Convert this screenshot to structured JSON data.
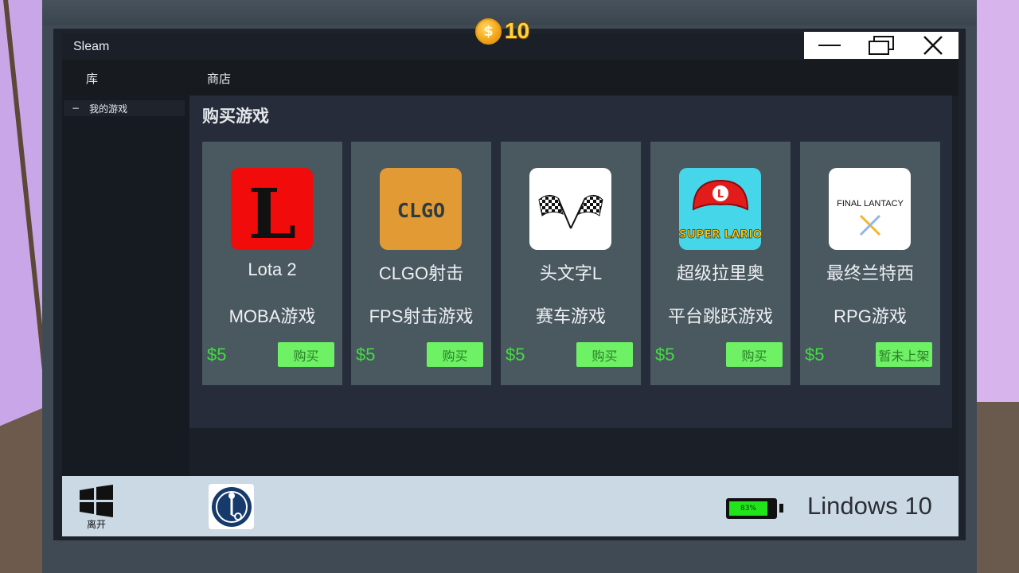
{
  "hud": {
    "coin_symbol": "$",
    "coins": "10"
  },
  "window": {
    "title": "Sleam"
  },
  "nav": {
    "library": "库",
    "store": "商店"
  },
  "sidebar": {
    "collapse_symbol": "−",
    "my_games": "我的游戏"
  },
  "store": {
    "heading": "购买游戏",
    "games": [
      {
        "name": "Lota 2",
        "genre": "MOBA游戏",
        "price": "$5",
        "button": "购买",
        "icon": "lota-logo-icon",
        "icon_text": "L"
      },
      {
        "name": "CLGO射击",
        "genre": "FPS射击游戏",
        "price": "$5",
        "button": "购买",
        "icon": "clgo-logo-icon",
        "icon_text": "CLGO"
      },
      {
        "name": "头文字L",
        "genre": "赛车游戏",
        "price": "$5",
        "button": "购买",
        "icon": "checkered-flags-icon"
      },
      {
        "name": "超级拉里奥",
        "genre": "平台跳跃游戏",
        "price": "$5",
        "button": "购买",
        "icon": "super-lario-logo-icon",
        "icon_text": "SUPER LARIO",
        "cap_letter": "L"
      },
      {
        "name": "最终兰特西",
        "genre": "RPG游戏",
        "price": "$5",
        "button": "暂未上架",
        "icon": "final-lantacy-logo-icon",
        "icon_text": "FINAL LANTACY"
      }
    ]
  },
  "taskbar": {
    "start_label": "离开",
    "battery_percent": "83%",
    "battery_level": 0.83,
    "os_name": "Lindows 10"
  },
  "colors": {
    "price": "#3ee13b",
    "buy_button": "#6ef165",
    "card": "#4a5860",
    "taskbar": "#cbd9e5",
    "coin": "#ffd23f"
  }
}
